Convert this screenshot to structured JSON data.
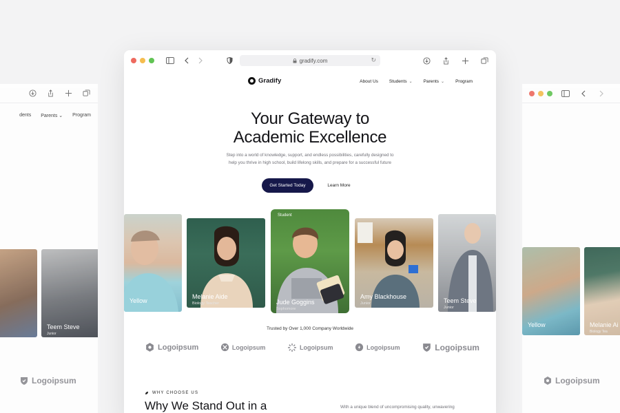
{
  "browser": {
    "url": "gradify.com",
    "traffic_colors": [
      "#ee6a5f",
      "#f5bd4f",
      "#61c454"
    ]
  },
  "site": {
    "brand": "Gradify",
    "nav": [
      {
        "label": "About Us",
        "has_menu": false
      },
      {
        "label": "Students",
        "has_menu": true
      },
      {
        "label": "Parents",
        "has_menu": true
      },
      {
        "label": "Program",
        "has_menu": false
      }
    ],
    "hero": {
      "title_line1": "Your Gateway to",
      "title_line2": "Academic Excellence",
      "subtitle_line1": "Step into a world of knowledge, support, and endless possibilities, carefully designed to",
      "subtitle_line2": "help you thrive in high school, build lifelong skills, and prepare for a successful future",
      "primary_cta": "Get Started Today",
      "secondary_cta": "Learn More"
    },
    "people": [
      {
        "name": "Yellow",
        "role": ""
      },
      {
        "name": "Melanie Aide",
        "role": "Biology Teacher"
      },
      {
        "name": "Jude Goggins",
        "role": "Sophomore",
        "badge": "Student"
      },
      {
        "name": "Amy Blackhouse",
        "role": "Junior"
      },
      {
        "name": "Teem Steve",
        "role": "Junior"
      }
    ],
    "trusted_text": "Trusted by Over 1,000 Company Worldwide",
    "logos": [
      "Logoipsum",
      "Logoipsum",
      "Logoipsum",
      "Logoipsum",
      "Logoipsum"
    ],
    "why": {
      "tag": "WHY CHOOSE US",
      "title": "Why We Stand Out in a",
      "text": "With a unique blend of uncompromising quality, unwavering"
    }
  },
  "side_left": {
    "nav": [
      "dents",
      "Parents",
      "Program"
    ],
    "cards": [
      {
        "name": "use",
        "role": ""
      },
      {
        "name": "Teem Steve",
        "role": "Junior"
      }
    ],
    "logo": "Logoipsum"
  },
  "side_right": {
    "cards": [
      {
        "name": "Yellow",
        "role": ""
      },
      {
        "name": "Melanie Ai",
        "role": "Biology Tea"
      }
    ],
    "logo": "Logoipsum"
  },
  "colors": {
    "cta_primary": "#16184a",
    "logo_gray": "#8a8a90"
  }
}
